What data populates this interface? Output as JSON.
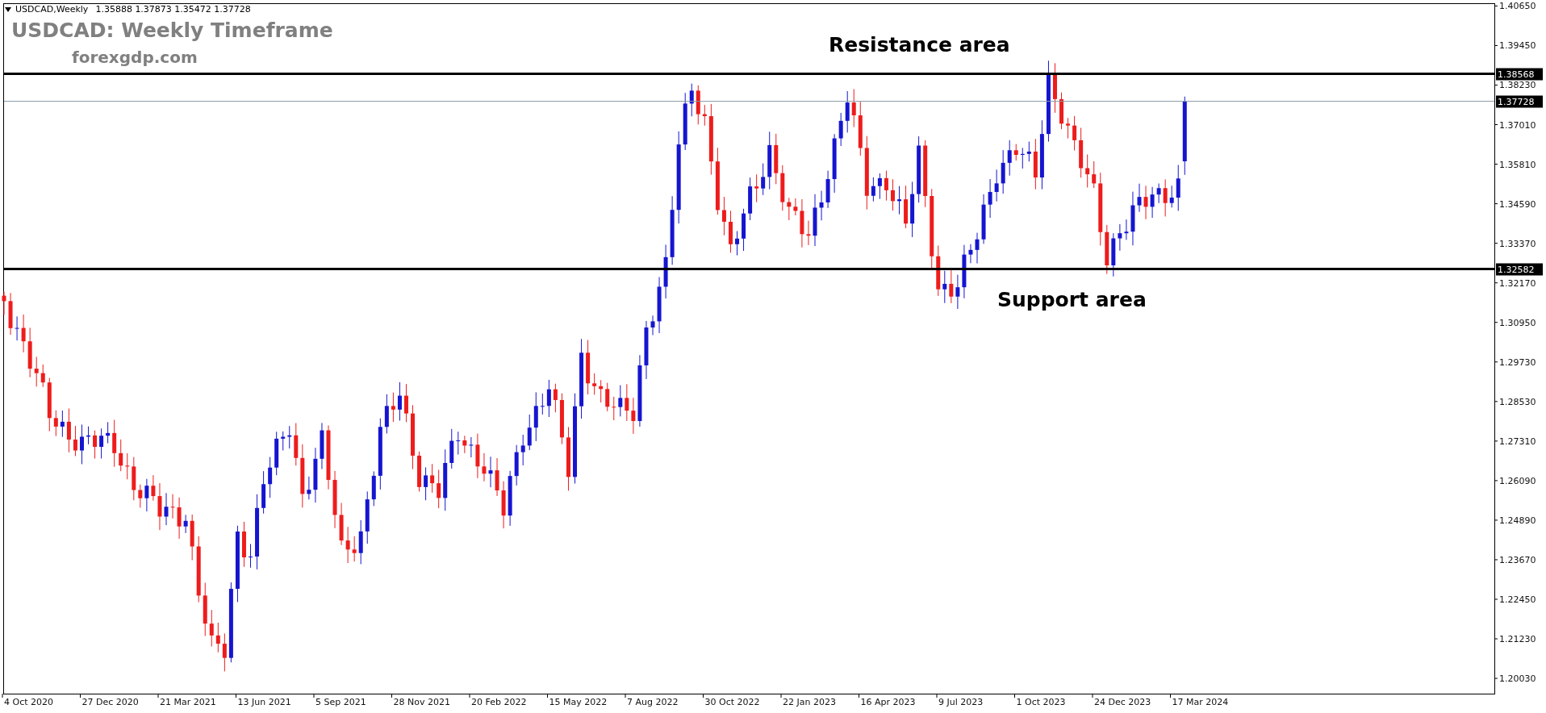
{
  "header": {
    "symbol": "USDCAD,Weekly",
    "ohlc": "1.35888 1.37873 1.35472 1.37728"
  },
  "title": "USDCAD: Weekly Timeframe",
  "website": "forexgdp.com",
  "annotations": [
    {
      "kind": "resistance",
      "text": "Resistance area"
    },
    {
      "kind": "support",
      "text": "Support area"
    }
  ],
  "price_lines": [
    {
      "kind": "resistance",
      "label": "1.38568"
    },
    {
      "kind": "bid",
      "label": "1.37728"
    },
    {
      "kind": "support",
      "label": "1.32582"
    }
  ],
  "price_axis": [
    "1.40650",
    "1.39450",
    "1.38230",
    "1.37010",
    "1.35810",
    "1.34590",
    "1.33370",
    "1.32170",
    "1.30950",
    "1.29730",
    "1.28530",
    "1.27310",
    "1.26090",
    "1.24890",
    "1.23670",
    "1.22450",
    "1.21230",
    "1.20030"
  ],
  "time_axis": [
    "4 Oct 2020",
    "27 Dec 2020",
    "21 Mar 2021",
    "13 Jun 2021",
    "5 Sep 2021",
    "28 Nov 2021",
    "20 Feb 2022",
    "15 May 2022",
    "7 Aug 2022",
    "30 Oct 2022",
    "22 Jan 2023",
    "16 Apr 2023",
    "9 Jul 2023",
    "1 Oct 2023",
    "24 Dec 2023",
    "17 Mar 2024"
  ]
}
